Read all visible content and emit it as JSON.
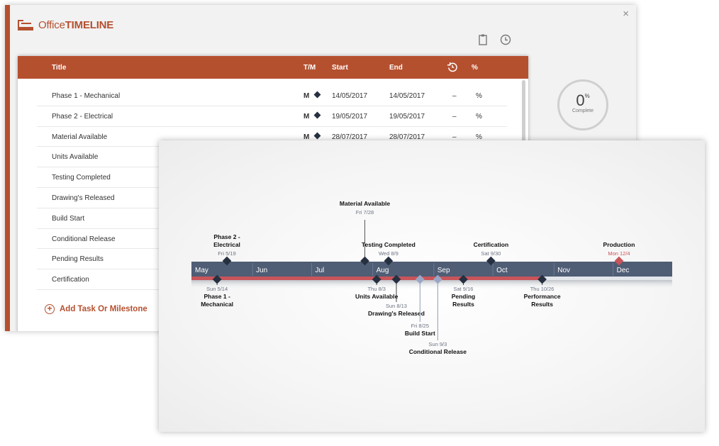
{
  "app": {
    "logo_office": "Office",
    "logo_timeline": "TIMELINE",
    "close_glyph": "×",
    "tools": [
      {
        "name": "clipboard-icon"
      },
      {
        "name": "clock-icon"
      }
    ]
  },
  "table": {
    "headers": {
      "title": "Title",
      "tm": "T/M",
      "start": "Start",
      "end": "End",
      "shift_icon": "history-icon",
      "percent": "%"
    },
    "rows": [
      {
        "title": "Phase 1 - Mechanical",
        "tm": "M",
        "start": "14/05/2017",
        "end": "14/05/2017",
        "shift": "–",
        "percent": "%"
      },
      {
        "title": "Phase 2 - Electrical",
        "tm": "M",
        "start": "19/05/2017",
        "end": "19/05/2017",
        "shift": "–",
        "percent": "%"
      },
      {
        "title": "Material Available",
        "tm": "M",
        "start": "28/07/2017",
        "end": "28/07/2017",
        "shift": "–",
        "percent": "%"
      },
      {
        "title": "Units Available"
      },
      {
        "title": "Testing Completed"
      },
      {
        "title": "Drawing's Released"
      },
      {
        "title": "Build Start"
      },
      {
        "title": "Conditional Release"
      },
      {
        "title": "Pending Results"
      },
      {
        "title": "Certification"
      }
    ],
    "add_label": "Add Task Or Milestone"
  },
  "progress": {
    "value": "0",
    "unit": "%",
    "label": "Complete"
  },
  "colors": {
    "accent": "#b5502f",
    "band": "#4f5d75",
    "progress_line": "#c9545a",
    "milestone_dark": "#263040",
    "milestone_light": "#9aa6c4",
    "milestone_red": "#c9545a"
  },
  "chart_data": {
    "type": "timeline",
    "months": [
      "May",
      "Jun",
      "Jul",
      "Aug",
      "Sep",
      "Oct",
      "Nov",
      "Dec"
    ],
    "range": [
      "2017-05-01",
      "2017-12-31"
    ],
    "progress_until": "2017-10-26",
    "milestones": [
      {
        "label": "Phase 1 - Mechanical",
        "date_label": "Sun 5/14",
        "date": "2017-05-14",
        "side": "below",
        "style": "dark",
        "stem": 0
      },
      {
        "label": "Phase 2 - Electrical",
        "date_label": "Fri 5/19",
        "date": "2017-05-19",
        "side": "above",
        "style": "dark",
        "stem": 0
      },
      {
        "label": "Material Available",
        "date_label": "Fri 7/28",
        "date": "2017-07-28",
        "side": "above",
        "style": "dark",
        "stem": 1
      },
      {
        "label": "Units Available",
        "date_label": "Thu 8/3",
        "date": "2017-08-03",
        "side": "below",
        "style": "dark",
        "stem": 0
      },
      {
        "label": "Testing Completed",
        "date_label": "Wed 8/9",
        "date": "2017-08-09",
        "side": "above",
        "style": "dark",
        "stem": 0
      },
      {
        "label": "Drawing's Released",
        "date_label": "Sun 8/13",
        "date": "2017-08-13",
        "side": "below",
        "style": "dark",
        "stem": 1
      },
      {
        "label": "Build Start",
        "date_label": "Fri 8/25",
        "date": "2017-08-25",
        "side": "below",
        "style": "light",
        "stem": 2
      },
      {
        "label": "Conditional Release",
        "date_label": "Sun 9/3",
        "date": "2017-09-03",
        "side": "below",
        "style": "light",
        "stem": 3
      },
      {
        "label": "Pending Results",
        "date_label": "Sat 9/16",
        "date": "2017-09-16",
        "side": "below",
        "style": "dark",
        "stem": 0
      },
      {
        "label": "Certification",
        "date_label": "Sat 9/30",
        "date": "2017-09-30",
        "side": "above",
        "style": "dark",
        "stem": 0
      },
      {
        "label": "Performance Results",
        "date_label": "Thu 10/26",
        "date": "2017-10-26",
        "side": "below",
        "style": "dark",
        "stem": 0
      },
      {
        "label": "Production",
        "date_label": "Mon 12/4",
        "date": "2017-12-04",
        "side": "above",
        "style": "red",
        "stem": 0
      }
    ]
  }
}
